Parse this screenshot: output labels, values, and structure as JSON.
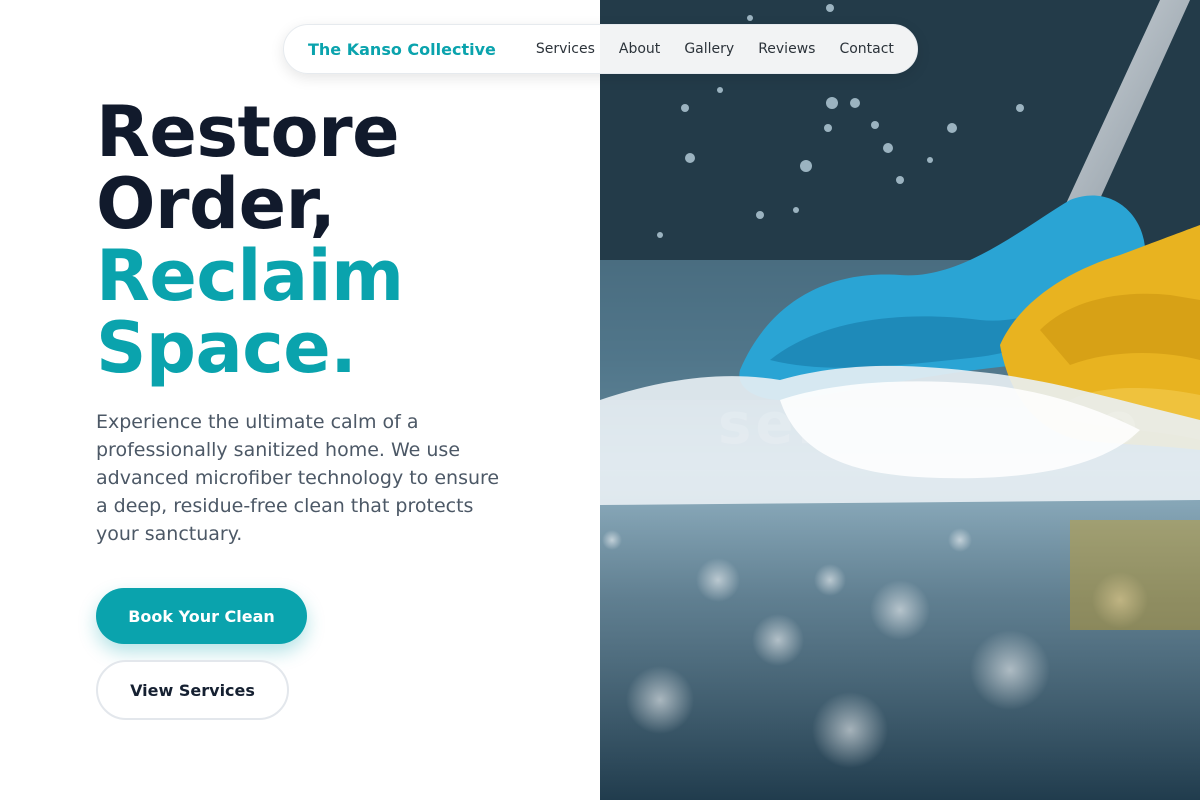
{
  "navbar": {
    "brand": "The Kanso Collective",
    "links": [
      "Services",
      "About",
      "Gallery",
      "Reviews",
      "Contact"
    ]
  },
  "hero": {
    "headline_dark": [
      "Restore",
      "Order,"
    ],
    "headline_accent": [
      "Reclaim",
      "Space."
    ],
    "description": "Experience the ultimate calm of a professionally sanitized home. We use advanced microfiber technology to ensure a deep, residue-free clean that protects your sanctuary.",
    "primary_button": "Book Your Clean",
    "secondary_button": "View Services",
    "image_watermark": "seisoutokyo"
  },
  "colors": {
    "accent": "#0aa3ad",
    "heading": "#111a2c",
    "body_text": "#4c5866",
    "glove": "#e8b320",
    "mop": "#2aa4d4"
  }
}
